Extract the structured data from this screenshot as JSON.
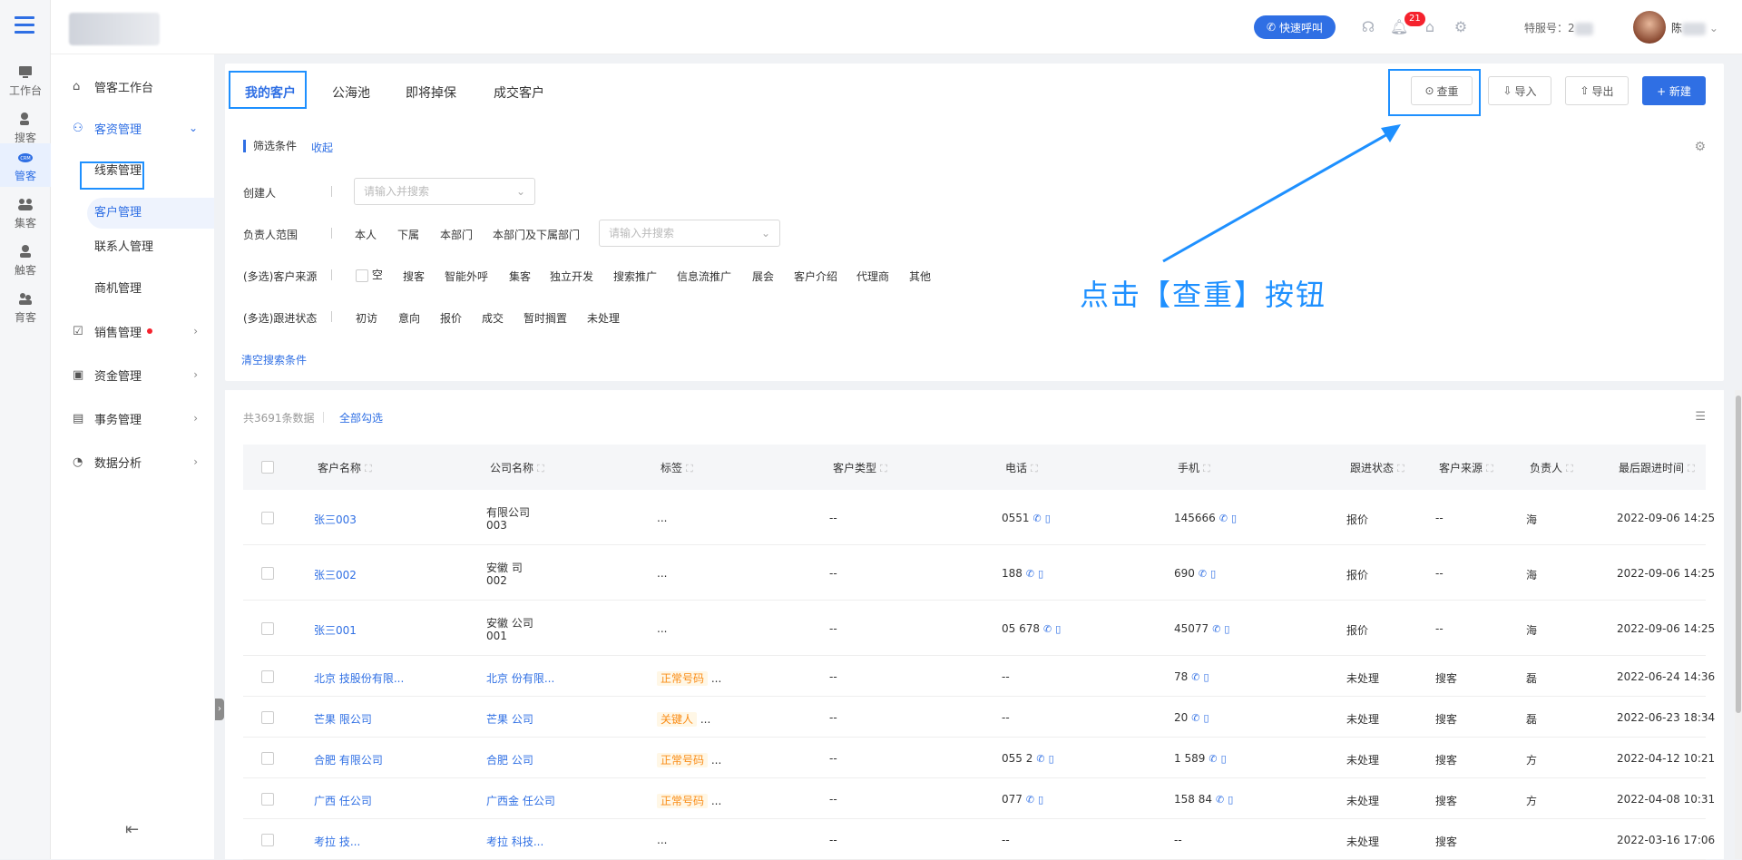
{
  "rail": [
    {
      "label": "工作台",
      "icon": "monitor-icon"
    },
    {
      "label": "搜客",
      "icon": "person-search-icon"
    },
    {
      "label": "管客",
      "icon": "crm-cloud-icon"
    },
    {
      "label": "集客",
      "icon": "group-icon"
    },
    {
      "label": "触客",
      "icon": "contact-icon"
    },
    {
      "label": "育客",
      "icon": "nurture-icon"
    }
  ],
  "topbar": {
    "quick_call": "快速呼叫",
    "notification_count": "21",
    "service_label": "特服号：2",
    "user_name": "陈"
  },
  "sidebar": {
    "workbench": "管客工作台",
    "resource_mgmt": "客资管理",
    "subs": [
      "线索管理",
      "客户管理",
      "联系人管理",
      "商机管理"
    ],
    "sales": "销售管理",
    "funds": "资金管理",
    "affairs": "事务管理",
    "analytics": "数据分析"
  },
  "tabs": [
    "我的客户",
    "公海池",
    "即将掉保",
    "成交客户"
  ],
  "actions": {
    "dedupe": "查重",
    "import": "导入",
    "export": "导出",
    "new": "+ 新建"
  },
  "filter": {
    "title": "筛选条件",
    "collapse": "收起",
    "creator_label": "创建人",
    "creator_placeholder": "请输入并搜索",
    "owner_label": "负责人范围",
    "owner_options": [
      "本人",
      "下属",
      "本部门",
      "本部门及下属部门"
    ],
    "owner_placeholder": "请输入并搜索",
    "source_label": "(多选)客户来源",
    "source_options": [
      "空",
      "搜客",
      "智能外呼",
      "集客",
      "独立开发",
      "搜索推广",
      "信息流推广",
      "展会",
      "客户介绍",
      "代理商",
      "其他"
    ],
    "status_label": "(多选)跟进状态",
    "status_options": [
      "初访",
      "意向",
      "报价",
      "成交",
      "暂时搁置",
      "未处理"
    ],
    "clear": "清空搜索条件"
  },
  "list": {
    "count": "共3691条数据",
    "select_all": "全部勾选",
    "columns": [
      "客户名称",
      "公司名称",
      "标签",
      "客户类型",
      "电话",
      "手机",
      "跟进状态",
      "客户来源",
      "负责人",
      "最后跟进时间"
    ],
    "rows": [
      {
        "name": "张三003",
        "company": "有限公司",
        "company2": "003",
        "tag": "...",
        "type": "--",
        "tel": "0551",
        "mobile": "145666",
        "status": "报价",
        "source": "--",
        "owner": "海",
        "time": "2022-09-06 14:25"
      },
      {
        "name": "张三002",
        "company": "安徽 司",
        "company2": "002",
        "tag": "...",
        "type": "--",
        "tel": "188",
        "mobile": "690",
        "status": "报价",
        "source": "--",
        "owner": "海",
        "time": "2022-09-06 14:25"
      },
      {
        "name": "张三001",
        "company": "安徽 公司",
        "company2": "001",
        "tag": "...",
        "type": "--",
        "tel": "05 678",
        "mobile": "45077",
        "status": "报价",
        "source": "--",
        "owner": "海",
        "time": "2022-09-06 14:25"
      },
      {
        "name": "北京 技股份有限...",
        "company": "北京 份有限...",
        "company2": "",
        "tag": "正常号码",
        "type": "--",
        "tel": "--",
        "mobile": "78",
        "status": "未处理",
        "source": "搜客",
        "owner": "磊",
        "time": "2022-06-24 14:36"
      },
      {
        "name": "芒果 限公司",
        "company": "芒果 公司",
        "company2": "",
        "tag": "关键人",
        "type": "--",
        "tel": "--",
        "mobile": "20",
        "status": "未处理",
        "source": "搜客",
        "owner": "磊",
        "time": "2022-06-23 18:34"
      },
      {
        "name": "合肥 有限公司",
        "company": "合肥 公司",
        "company2": "",
        "tag": "正常号码",
        "type": "--",
        "tel": "055 2",
        "mobile": "1 589",
        "status": "未处理",
        "source": "搜客",
        "owner": "方",
        "time": "2022-04-12 10:21"
      },
      {
        "name": "广西 任公司",
        "company": "广西金 任公司",
        "company2": "",
        "tag": "正常号码",
        "type": "--",
        "tel": "077",
        "mobile": "158 84",
        "status": "未处理",
        "source": "搜客",
        "owner": "方",
        "time": "2022-04-08 10:31"
      },
      {
        "name": "考拉 技...",
        "company": "考拉 科技...",
        "company2": "",
        "tag": "...",
        "type": "--",
        "tel": "--",
        "mobile": "--",
        "status": "未处理",
        "source": "搜客",
        "owner": "",
        "time": "2022-03-16 17:06"
      }
    ]
  },
  "annotation": "点击【查重】按钮",
  "colors": {
    "primary": "#2f6fe4",
    "highlight": "#1e90ff",
    "tag": "#fa8c16"
  }
}
